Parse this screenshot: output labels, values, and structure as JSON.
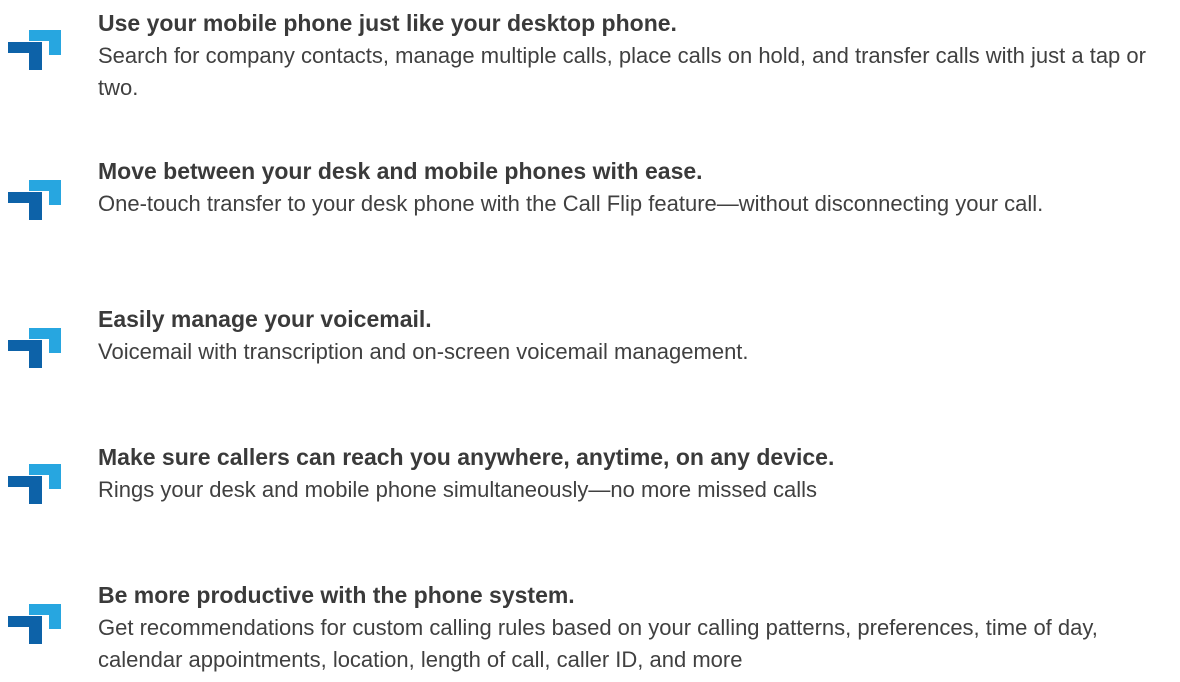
{
  "colors": {
    "icon_light": "#27a6e0",
    "icon_dark": "#0d62a8",
    "title": "#3a3a3a",
    "body": "#404040"
  },
  "features": [
    {
      "icon": "bracket-logo-icon",
      "title": "Use your mobile phone just like your desktop phone.",
      "description": "Search for company contacts, manage multiple calls, place calls on hold, and transfer calls with just a tap or two."
    },
    {
      "icon": "bracket-logo-icon",
      "title": "Move between your desk and mobile phones with ease.",
      "description": "One-touch transfer to your desk phone with the Call Flip feature—without disconnecting your call."
    },
    {
      "icon": "bracket-logo-icon",
      "title": "Easily manage your voicemail.",
      "description": "Voicemail with transcription and on-screen voicemail management."
    },
    {
      "icon": "bracket-logo-icon",
      "title": "Make sure callers can reach you anywhere, anytime, on any device.",
      "description": "Rings your desk and mobile phone simultaneously—no more missed calls"
    },
    {
      "icon": "bracket-logo-icon",
      "title": "Be more productive with the phone system.",
      "description": "Get recommendations for custom calling rules based on your calling patterns, preferences, time of day, calendar appointments, location, length of call, caller ID, and more"
    }
  ]
}
